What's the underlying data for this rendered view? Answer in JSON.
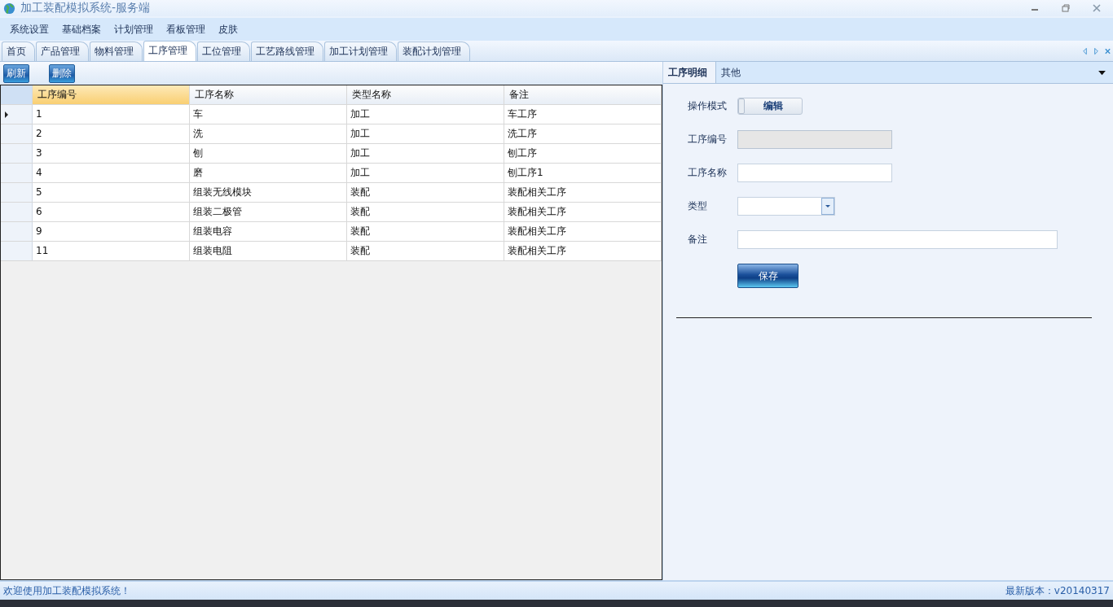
{
  "window": {
    "title": "加工装配模拟系统-服务端"
  },
  "menu": [
    "系统设置",
    "基础档案",
    "计划管理",
    "看板管理",
    "皮肤"
  ],
  "tabs": [
    {
      "label": "首页",
      "selected": false
    },
    {
      "label": "产品管理",
      "selected": false
    },
    {
      "label": "物料管理",
      "selected": false
    },
    {
      "label": "工序管理",
      "selected": true
    },
    {
      "label": "工位管理",
      "selected": false
    },
    {
      "label": "工艺路线管理",
      "selected": false
    },
    {
      "label": "加工计划管理",
      "selected": false
    },
    {
      "label": "装配计划管理",
      "selected": false
    }
  ],
  "toolbar": [
    "刷新",
    "删除"
  ],
  "table": {
    "columns": [
      {
        "label": "工序编号",
        "selected": true
      },
      {
        "label": "工序名称",
        "selected": false
      },
      {
        "label": "类型名称",
        "selected": false
      },
      {
        "label": "备注",
        "selected": false
      }
    ],
    "rows": [
      {
        "selected": true,
        "cells": [
          "1",
          "车",
          "加工",
          "车工序"
        ]
      },
      {
        "selected": false,
        "cells": [
          "2",
          "洗",
          "加工",
          "洗工序"
        ]
      },
      {
        "selected": false,
        "cells": [
          "3",
          "刨",
          "加工",
          "刨工序"
        ]
      },
      {
        "selected": false,
        "cells": [
          "4",
          "磨",
          "加工",
          "刨工序1"
        ]
      },
      {
        "selected": false,
        "cells": [
          "5",
          "组装无线模块",
          "装配",
          "装配相关工序"
        ]
      },
      {
        "selected": false,
        "cells": [
          "6",
          "组装二极管",
          "装配",
          "装配相关工序"
        ]
      },
      {
        "selected": false,
        "cells": [
          "9",
          "组装电容",
          "装配",
          "装配相关工序"
        ]
      },
      {
        "selected": false,
        "cells": [
          "11",
          "组装电阻",
          "装配",
          "装配相关工序"
        ]
      }
    ]
  },
  "detail": {
    "tabs": [
      {
        "label": "工序明细",
        "selected": true
      },
      {
        "label": "其他",
        "selected": false
      }
    ],
    "fields": [
      {
        "kind": "toggle",
        "label": "操作模式",
        "value": "编辑",
        "on": false
      },
      {
        "kind": "text",
        "label": "工序编号",
        "disabled": true
      },
      {
        "kind": "text",
        "label": "工序名称",
        "disabled": false
      },
      {
        "kind": "dropdown",
        "label": "类型"
      },
      {
        "kind": "wide",
        "label": "备注"
      }
    ],
    "save_button": "保存"
  },
  "status_bar": {
    "message": "欢迎使用加工装配模拟系统！",
    "version": "最新版本：v20140317"
  }
}
